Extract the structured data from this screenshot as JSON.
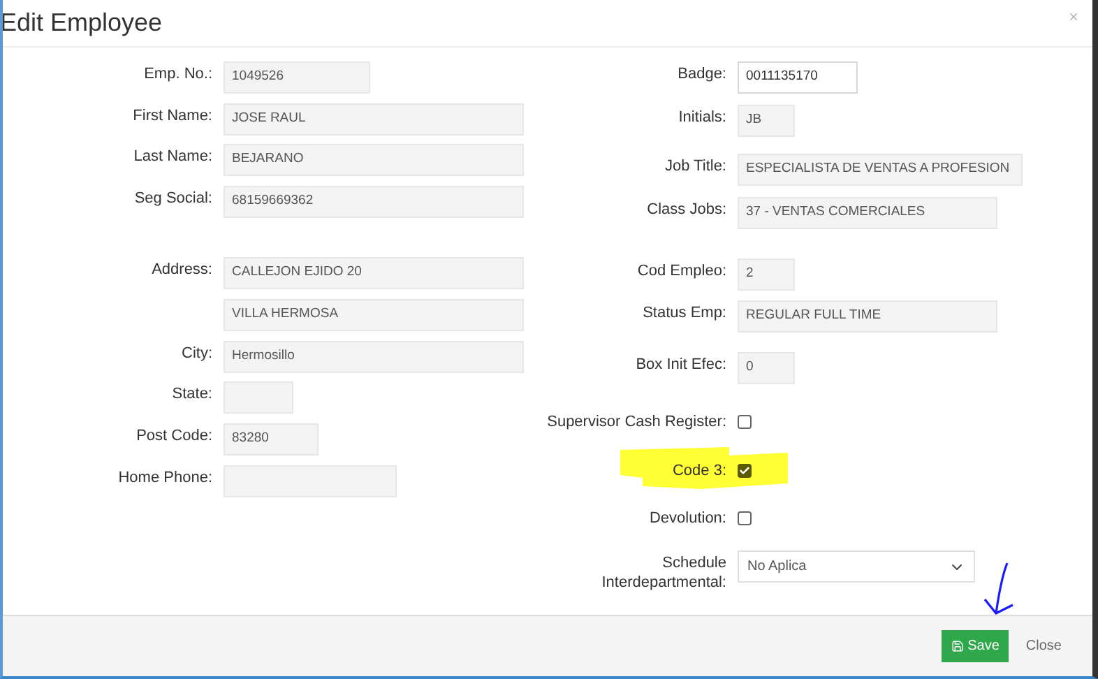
{
  "dialog": {
    "title": "Edit Employee",
    "close_icon": "×"
  },
  "left_fields": [
    {
      "kind": "text",
      "label": "Emp. No.:",
      "value": "1049526",
      "disabled": true
    },
    {
      "kind": "text",
      "label": "First Name:",
      "value": "JOSE RAUL",
      "disabled": true
    },
    {
      "kind": "text",
      "label": "Last Name:",
      "value": "BEJARANO",
      "disabled": true
    },
    {
      "kind": "text",
      "label": "Seg Social:",
      "value": "68159669362",
      "disabled": true
    },
    {
      "kind": "text",
      "label": "Address:",
      "value": "CALLEJON EJIDO 20",
      "disabled": true
    },
    {
      "kind": "text",
      "value": "VILLA HERMOSA",
      "disabled": true
    },
    {
      "kind": "text",
      "label": "City:",
      "value": "Hermosillo",
      "disabled": true
    },
    {
      "kind": "text",
      "label": "State:",
      "disabled": true
    },
    {
      "kind": "text",
      "label": "Post Code:",
      "value": "83280",
      "disabled": true
    },
    {
      "kind": "text",
      "label": "Home Phone:",
      "disabled": true
    }
  ],
  "right_fields": [
    {
      "kind": "text",
      "label": "Badge:",
      "value": "0011135170",
      "disabled": false
    },
    {
      "kind": "text",
      "label": "Initials:",
      "value": "JB",
      "disabled": true
    },
    {
      "kind": "text",
      "label": "Job Title:",
      "value": "ESPECIALISTA DE VENTAS A PROFESION",
      "disabled": true
    },
    {
      "kind": "text",
      "label": "Class Jobs:",
      "value": "37 - VENTAS COMERCIALES",
      "disabled": true
    },
    {
      "kind": "text",
      "label": "Cod Empleo:",
      "value": "2",
      "disabled": true
    },
    {
      "kind": "text",
      "label": "Status Emp:",
      "value": "REGULAR FULL TIME",
      "disabled": true
    },
    {
      "kind": "text",
      "label": "Box Init Efec:",
      "value": "0",
      "disabled": true
    },
    {
      "kind": "checkbox",
      "label": "Supervisor Cash Register:",
      "checked": false
    },
    {
      "kind": "checkbox",
      "label": "Code 3:",
      "checked": true,
      "highlighted": true
    },
    {
      "kind": "checkbox",
      "label": "Devolution:",
      "checked": false
    },
    {
      "kind": "select",
      "label": "Schedule Interdepartmental:",
      "value": "No Aplica"
    }
  ],
  "footer": {
    "buttons": [
      {
        "kind": "primary",
        "label": "Save"
      },
      {
        "kind": "link",
        "label": "Close"
      }
    ]
  }
}
